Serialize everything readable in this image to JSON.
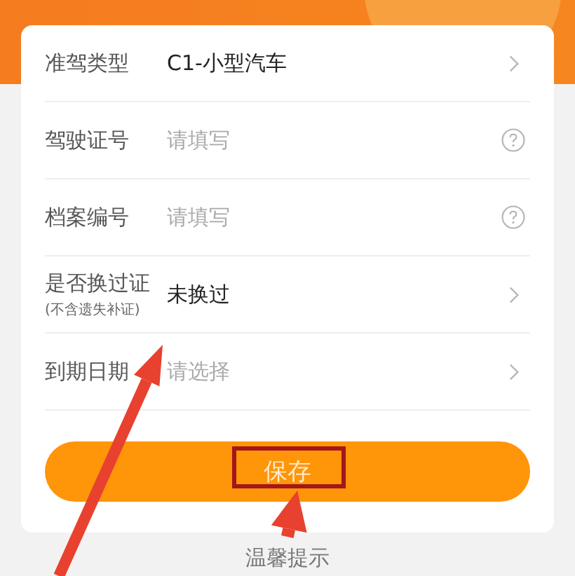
{
  "rows": [
    {
      "label": "准驾类型",
      "value": "C1-小型汽车",
      "kind": "select"
    },
    {
      "label": "驾驶证号",
      "placeholder": "请填写",
      "kind": "help"
    },
    {
      "label": "档案编号",
      "placeholder": "请填写",
      "kind": "help"
    },
    {
      "label": "是否换过证",
      "note": "(不含遗失补证)",
      "value": "未换过",
      "kind": "select"
    },
    {
      "label": "到期日期",
      "placeholder": "请选择",
      "kind": "select"
    }
  ],
  "save_button": {
    "label": "保存"
  },
  "tip_heading": "温馨提示"
}
